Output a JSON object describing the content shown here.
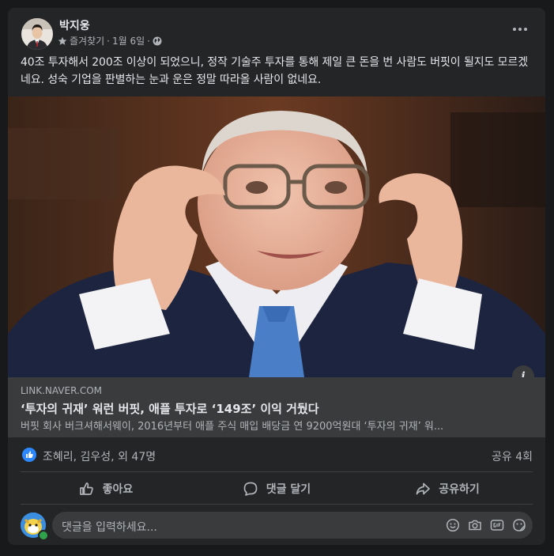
{
  "post": {
    "author": "박지웅",
    "meta_sep1": "·",
    "audience": "즐겨찾기",
    "date": "1월 6일",
    "meta_sep2": "·",
    "text": "40조 투자해서 200조 이상이 되었으니, 정작 기술주 투자를 통해 제일 큰 돈을 번 사람도 버핏이 될지도 모르겠네요. 성숙 기업을 판별하는 눈과 운은 정말 따라올 사람이 없네요."
  },
  "link": {
    "domain": "LINK.NAVER.COM",
    "title": "‘투자의 귀재’ 워런 버핏, 애플 투자로 ‘149조’ 이익 거뒀다",
    "description": "버핏 회사 버크셔해서웨이, 2016년부터 애플 주식 매입 배당금 연 9200억원대 ‘투자의 귀재’ 워...",
    "info_label": "i"
  },
  "stats": {
    "reactions_text": "조혜리, 김우성, 외 47명",
    "shares_text": "공유 4회"
  },
  "actions": {
    "like": "좋아요",
    "comment": "댓글 달기",
    "share": "공유하기"
  },
  "comment_box": {
    "placeholder": "댓글을 입력하세요..."
  },
  "colors": {
    "background": "#18191a",
    "card": "#242526",
    "like_blue": "#2d88ff"
  }
}
